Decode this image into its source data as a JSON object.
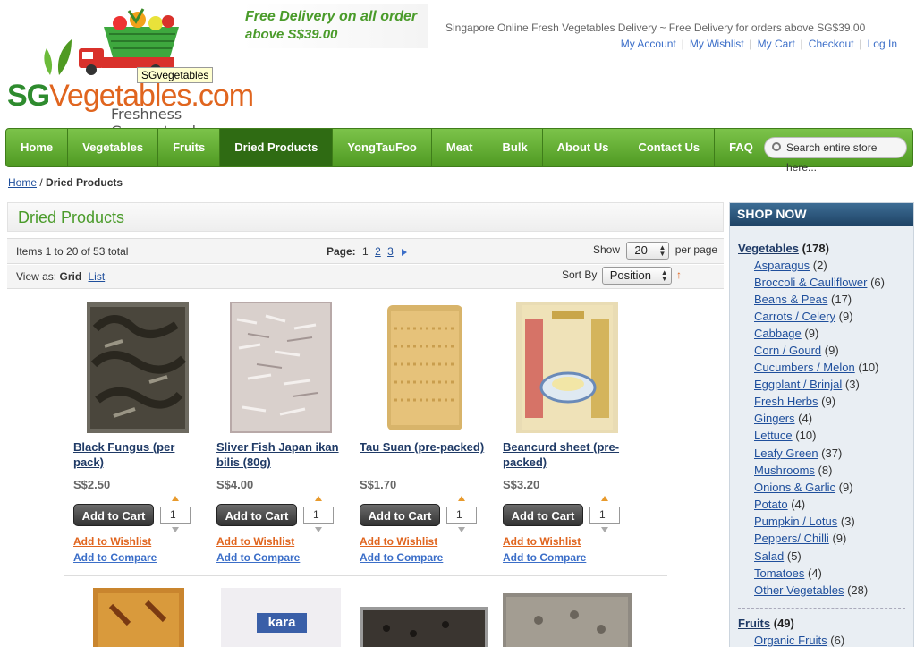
{
  "header": {
    "logo_sg": "SG",
    "logo_veg": "Vegetables.com",
    "tagline": "Freshness Guaranteed",
    "tooltip": "SGvegetables",
    "banner_line1_a": "Free Delivery",
    "banner_line1_b": "on all order",
    "banner_line2": "above S$39.00",
    "welcome": "Singapore Online Fresh Vegetables Delivery ~ Free Delivery for orders above SG$39.00",
    "links": [
      "My Account",
      "My Wishlist",
      "My Cart",
      "Checkout",
      "Log In"
    ]
  },
  "nav": {
    "items": [
      "Home",
      "Vegetables",
      "Fruits",
      "Dried Products",
      "YongTauFoo",
      "Meat",
      "Bulk",
      "About Us",
      "Contact Us",
      "FAQ"
    ],
    "active": "Dried Products",
    "search_placeholder": "Search entire store here..."
  },
  "breadcrumb": {
    "home": "Home",
    "sep": " / ",
    "current": "Dried Products"
  },
  "main": {
    "title": "Dried Products",
    "items_text": "Items 1 to 20 of 53 total",
    "page_label": "Page:",
    "pages": [
      "1",
      "2",
      "3"
    ],
    "show_label": "Show",
    "show_value": "20",
    "per_page": "per page",
    "view_as": "View as:",
    "view_grid": "Grid",
    "view_list": "List",
    "sort_label": "Sort By",
    "sort_value": "Position",
    "sort_dir": "↑"
  },
  "products": [
    {
      "name": "Black Fungus (per pack)",
      "price": "S$2.50",
      "qty": "1"
    },
    {
      "name": "Sliver Fish Japan ikan bilis (80g)",
      "price": "S$4.00",
      "qty": "1"
    },
    {
      "name": "Tau Suan (pre-packed)",
      "price": "S$1.70",
      "qty": "1"
    },
    {
      "name": "Beancurd sheet (pre-packed)",
      "price": "S$3.20",
      "qty": "1"
    }
  ],
  "product_labels": {
    "add_to_cart": "Add to Cart",
    "wishlist": "Add to Wishlist",
    "compare": "Add to Compare"
  },
  "second_row": {
    "kara_text": "kara"
  },
  "sidebar": {
    "heading": "SHOP NOW",
    "vegetables": {
      "label": "Vegetables",
      "count": "(178)"
    },
    "veg_items": [
      {
        "label": "Asparagus",
        "count": "(2)"
      },
      {
        "label": "Broccoli & Cauliflower",
        "count": "(6)"
      },
      {
        "label": "Beans & Peas",
        "count": "(17)"
      },
      {
        "label": "Carrots / Celery",
        "count": "(9)"
      },
      {
        "label": "Cabbage",
        "count": "(9)"
      },
      {
        "label": "Corn / Gourd",
        "count": "(9)"
      },
      {
        "label": "Cucumbers / Melon",
        "count": "(10)"
      },
      {
        "label": "Eggplant / Brinjal",
        "count": "(3)"
      },
      {
        "label": "Fresh Herbs",
        "count": "(9)"
      },
      {
        "label": "Gingers",
        "count": "(4)"
      },
      {
        "label": "Lettuce",
        "count": "(10)"
      },
      {
        "label": "Leafy Green",
        "count": "(37)"
      },
      {
        "label": "Mushrooms",
        "count": "(8)"
      },
      {
        "label": "Onions & Garlic",
        "count": "(9)"
      },
      {
        "label": "Potato",
        "count": "(4)"
      },
      {
        "label": "Pumpkin / Lotus",
        "count": "(3)"
      },
      {
        "label": "Peppers/ Chilli",
        "count": "(9)"
      },
      {
        "label": "Salad",
        "count": "(5)"
      },
      {
        "label": "Tomatoes",
        "count": "(4)"
      },
      {
        "label": "Other Vegetables",
        "count": "(28)"
      }
    ],
    "fruits": {
      "label": "Fruits",
      "count": "(49)"
    },
    "fruit_items": [
      {
        "label": "Organic Fruits",
        "count": "(6)"
      }
    ]
  },
  "colors": {
    "nav_green": "#5aa82c",
    "active_nav": "#2f6b13",
    "title_green": "#4a9b2a",
    "orange": "#e0651f",
    "link_blue": "#3b6ec8"
  }
}
